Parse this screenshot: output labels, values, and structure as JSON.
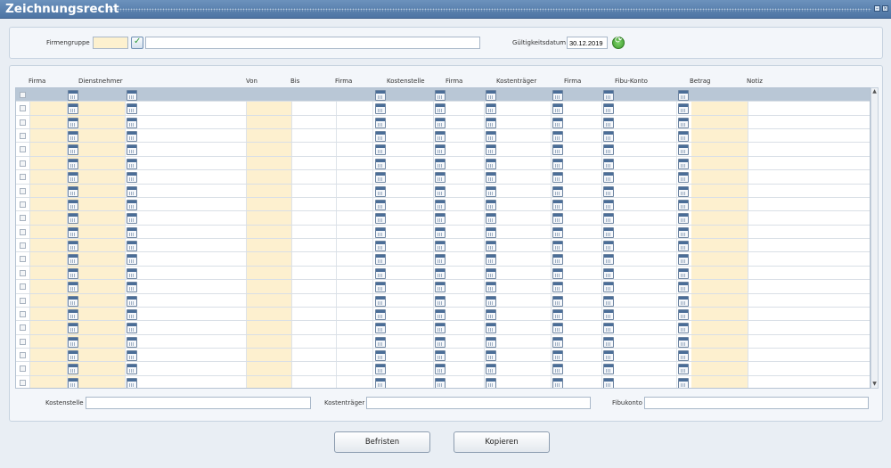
{
  "window": {
    "title": "Zeichnungsrecht"
  },
  "filter": {
    "firmengruppe_label": "Firmengruppe",
    "firmengruppe_code": "",
    "firmengruppe_name": "",
    "gueltigkeitsdatum_label": "Gültigkeitsdatum",
    "gueltigkeitsdatum_value": "30.12.2019"
  },
  "table": {
    "columns": [
      "Firma",
      "Dienstnehmer",
      "Von",
      "Bis",
      "Firma",
      "Kostenstelle",
      "Firma",
      "Kostenträger",
      "Firma",
      "Fibu-Konto",
      "Betrag",
      "Notiz"
    ],
    "row_count": 22
  },
  "details": {
    "kostenstelle_label": "Kostenstelle",
    "kostentraeger_label": "Kostenträger",
    "fibukonto_label": "Fibukonto",
    "kostenstelle_value": "",
    "kostentraeger_value": "",
    "fibukonto_value": ""
  },
  "actions": {
    "befristen_label": "Befristen",
    "kopieren_label": "Kopieren"
  },
  "icons": {
    "lookup": "lookup-check-icon",
    "calendar": "calendar-icon",
    "refresh": "refresh-icon"
  },
  "colors": {
    "titlebar": "#5b81ad",
    "required_field": "#fdf0cf",
    "selected_row": "#b9c7d6"
  }
}
